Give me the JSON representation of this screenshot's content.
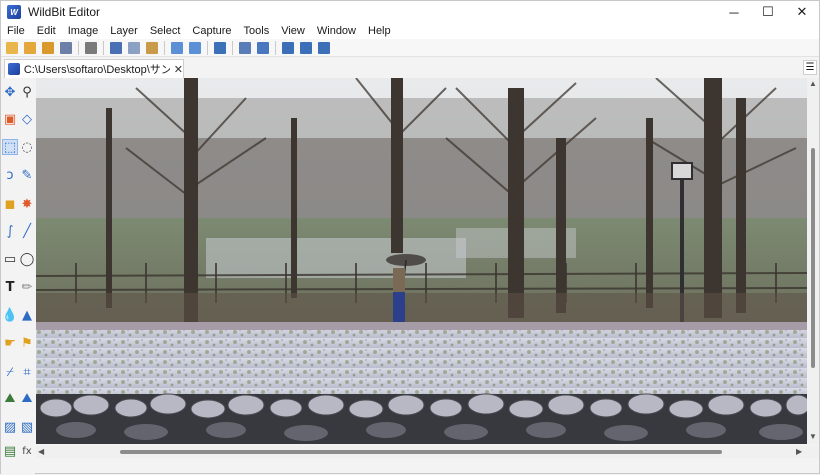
{
  "window": {
    "title": "WildBit Editor",
    "app_icon_text": "W"
  },
  "window_controls": {
    "minimize": "─",
    "maximize": "☐",
    "close": "✕"
  },
  "menu": [
    "File",
    "Edit",
    "Image",
    "Layer",
    "Select",
    "Capture",
    "Tools",
    "View",
    "Window",
    "Help"
  ],
  "toolbar": {
    "buttons": [
      {
        "name": "new-file-icon",
        "color": "#e8b64a"
      },
      {
        "name": "open-folder-icon",
        "color": "#e4a73b"
      },
      {
        "name": "open-recent-icon",
        "color": "#d99a2b"
      },
      {
        "name": "image-properties-icon",
        "color": "#6b7fa8"
      },
      {
        "sep": true
      },
      {
        "name": "print-icon",
        "color": "#7a7a7a"
      },
      {
        "sep": true
      },
      {
        "name": "cut-icon",
        "color": "#4a6fb5"
      },
      {
        "name": "copy-icon",
        "color": "#8aa0c4"
      },
      {
        "name": "paste-icon",
        "color": "#c89a4a"
      },
      {
        "sep": true
      },
      {
        "name": "undo-icon",
        "color": "#5b8fd6"
      },
      {
        "name": "redo-icon",
        "color": "#5b8fd6"
      },
      {
        "sep": true
      },
      {
        "name": "screen-capture-icon",
        "color": "#3b6fb8"
      },
      {
        "sep": true
      },
      {
        "name": "resize-image-icon",
        "color": "#5a7db8"
      },
      {
        "name": "batch-convert-icon",
        "color": "#4a78c0"
      },
      {
        "sep": true
      },
      {
        "name": "cascade-windows-icon",
        "color": "#3b6fb8"
      },
      {
        "name": "tile-horizontal-icon",
        "color": "#3b6fb8"
      },
      {
        "name": "tile-vertical-icon",
        "color": "#3b6fb8"
      }
    ]
  },
  "tab": {
    "label": "C:\\Users\\softaro\\Desktop\\サンプル\\...",
    "close": "✕",
    "menu_icon": "☰"
  },
  "palette": [
    {
      "name": "move-tool-icon",
      "glyph": "✥",
      "color": "#2d6bc4"
    },
    {
      "name": "zoom-tool-icon",
      "glyph": "⚲",
      "color": "#333333"
    },
    {
      "name": "crop-select-icon",
      "glyph": "▣",
      "color": "#e05a2b"
    },
    {
      "name": "transform-tool-icon",
      "glyph": "◇",
      "color": "#2d6bc4"
    },
    {
      "name": "rect-select-tool-icon",
      "glyph": "⬚",
      "color": "#2d6bc4",
      "active": true
    },
    {
      "name": "ellipse-select-tool-icon",
      "glyph": "◌",
      "color": "#555555"
    },
    {
      "name": "lasso-tool-icon",
      "glyph": "ↄ",
      "color": "#2d6bc4"
    },
    {
      "name": "brush-tool-icon",
      "glyph": "✎",
      "color": "#2d6bc4"
    },
    {
      "name": "fill-select-icon",
      "glyph": "◼",
      "color": "#e0a020"
    },
    {
      "name": "auto-select-icon",
      "glyph": "✸",
      "color": "#e05a2b"
    },
    {
      "name": "curve-tool-icon",
      "glyph": "∫",
      "color": "#2d6bc4"
    },
    {
      "name": "line-tool-icon",
      "glyph": "╱",
      "color": "#2d6bc4"
    },
    {
      "name": "rectangle-tool-icon",
      "glyph": "▭",
      "color": "#333333"
    },
    {
      "name": "ellipse-tool-icon",
      "glyph": "◯",
      "color": "#333333"
    },
    {
      "name": "text-tool-icon",
      "glyph": "T",
      "color": "#222222"
    },
    {
      "name": "pencil-tool-icon",
      "glyph": "✏",
      "color": "#888888"
    },
    {
      "name": "blur-tool-icon",
      "glyph": "💧",
      "color": "#2d6bc4"
    },
    {
      "name": "sharpen-tool-icon",
      "glyph": "▲",
      "color": "#2d6bc4"
    },
    {
      "name": "smudge-tool-icon",
      "glyph": "☛",
      "color": "#e0a020"
    },
    {
      "name": "stamp-tool-icon",
      "glyph": "⚑",
      "color": "#e0a020"
    },
    {
      "name": "eyedropper-tool-icon",
      "glyph": "⌿",
      "color": "#2d6bc4"
    },
    {
      "name": "crop-tool-icon",
      "glyph": "⌗",
      "color": "#2d6bc4"
    },
    {
      "name": "mountain-filter-icon",
      "glyph": "⛰",
      "color": "#3a7a3a"
    },
    {
      "name": "landscape-filter-icon",
      "glyph": "⛰",
      "color": "#2d6bc4"
    },
    {
      "name": "image-layer-icon",
      "glyph": "▨",
      "color": "#2d6bc4"
    },
    {
      "name": "layer-effect-icon",
      "glyph": "▧",
      "color": "#2d6bc4"
    },
    {
      "name": "photo-adjust-icon",
      "glyph": "▤",
      "color": "#3a7a3a"
    },
    {
      "name": "function-fx-icon",
      "glyph": "fx",
      "color": "#444444"
    }
  ],
  "scroll": {
    "up": "▲",
    "down": "▼",
    "left": "◀",
    "right": "▶"
  }
}
